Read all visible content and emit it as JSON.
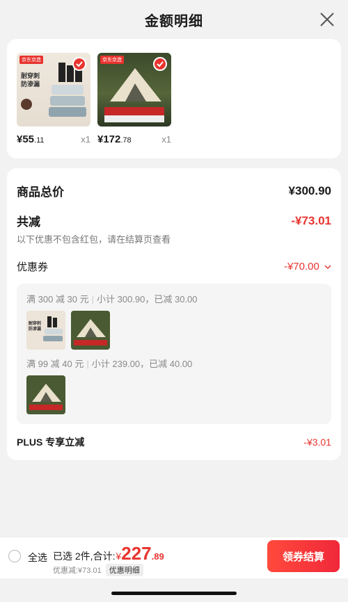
{
  "header": {
    "title": "金额明细"
  },
  "products": [
    {
      "price_int": "¥55",
      "price_dec": ".11",
      "qty": "x1",
      "tag": "京东京造",
      "kind": "bags"
    },
    {
      "price_int": "¥172",
      "price_dec": ".78",
      "qty": "x1",
      "tag": "京东京造",
      "kind": "tent"
    }
  ],
  "detail": {
    "total_label": "商品总价",
    "total_value": "¥300.90",
    "discount_label": "共减",
    "discount_value": "-¥73.01",
    "note": "以下优惠不包含红包，请在结算页查看",
    "coupon_label": "优惠券",
    "coupon_value": "-¥70.00",
    "rules": [
      {
        "title": "满 300 减 30 元",
        "info": "小计 300.90，已减 30.00"
      },
      {
        "title": "满 99 减 40 元",
        "info": "小计 239.00，已减 40.00"
      }
    ],
    "plus_label": "PLUS 专享立减",
    "plus_value": "-¥3.01"
  },
  "footer": {
    "select_all": "全选",
    "selected_text": "已选 2件,合计:",
    "currency": "¥",
    "total_int": "227",
    "total_dec": ".89",
    "discount_text": "优惠减:¥73.01",
    "detail_button": "优惠明细",
    "checkout_button": "领券结算"
  },
  "colors": {
    "accent": "#e8342f",
    "background": "#f2f2f2"
  }
}
